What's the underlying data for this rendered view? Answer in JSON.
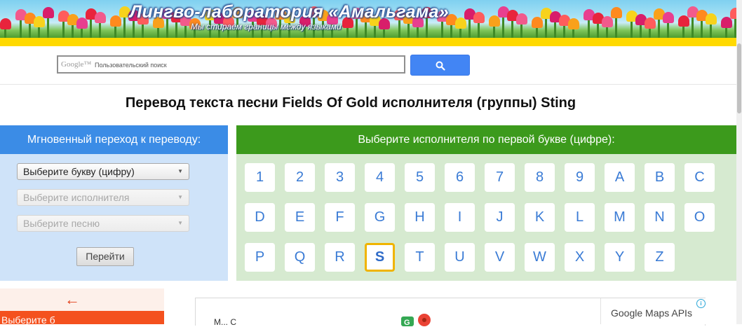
{
  "header": {
    "title": "Лингво-лаборатория «Амальгама»",
    "subtitle": "Мы стираем границы между языками"
  },
  "search": {
    "brand": "Google™",
    "placeholder": "Пользовательский поиск",
    "button_icon": "search-icon",
    "button_color": "#4285f4"
  },
  "page": {
    "title": "Перевод текста песни Fields Of Gold исполнителя (группы) Sting"
  },
  "quick_nav": {
    "heading": "Мгновенный переход к переводу:",
    "selects": [
      {
        "value": "Выберите букву (цифру)",
        "disabled": false
      },
      {
        "value": "Выберите исполнителя",
        "disabled": true
      },
      {
        "value": "Выберите песню",
        "disabled": true
      }
    ],
    "go_label": "Перейти",
    "accent": "#3b8ce6"
  },
  "letter_picker": {
    "heading": "Выберите исполнителя по первой букве (цифре):",
    "letters": [
      "1",
      "2",
      "3",
      "4",
      "5",
      "6",
      "7",
      "8",
      "9",
      "A",
      "B",
      "C",
      "D",
      "E",
      "F",
      "G",
      "H",
      "I",
      "J",
      "K",
      "L",
      "M",
      "N",
      "O",
      "P",
      "Q",
      "R",
      "S",
      "T",
      "U",
      "V",
      "W",
      "X",
      "Y",
      "Z"
    ],
    "selected": "S",
    "accent": "#3c9a1c"
  },
  "back_arrow": "←",
  "promo_text": "Выберите б",
  "map": {
    "snippet": "М...      С",
    "attribution": "Google Maps APIs",
    "info": "i"
  }
}
